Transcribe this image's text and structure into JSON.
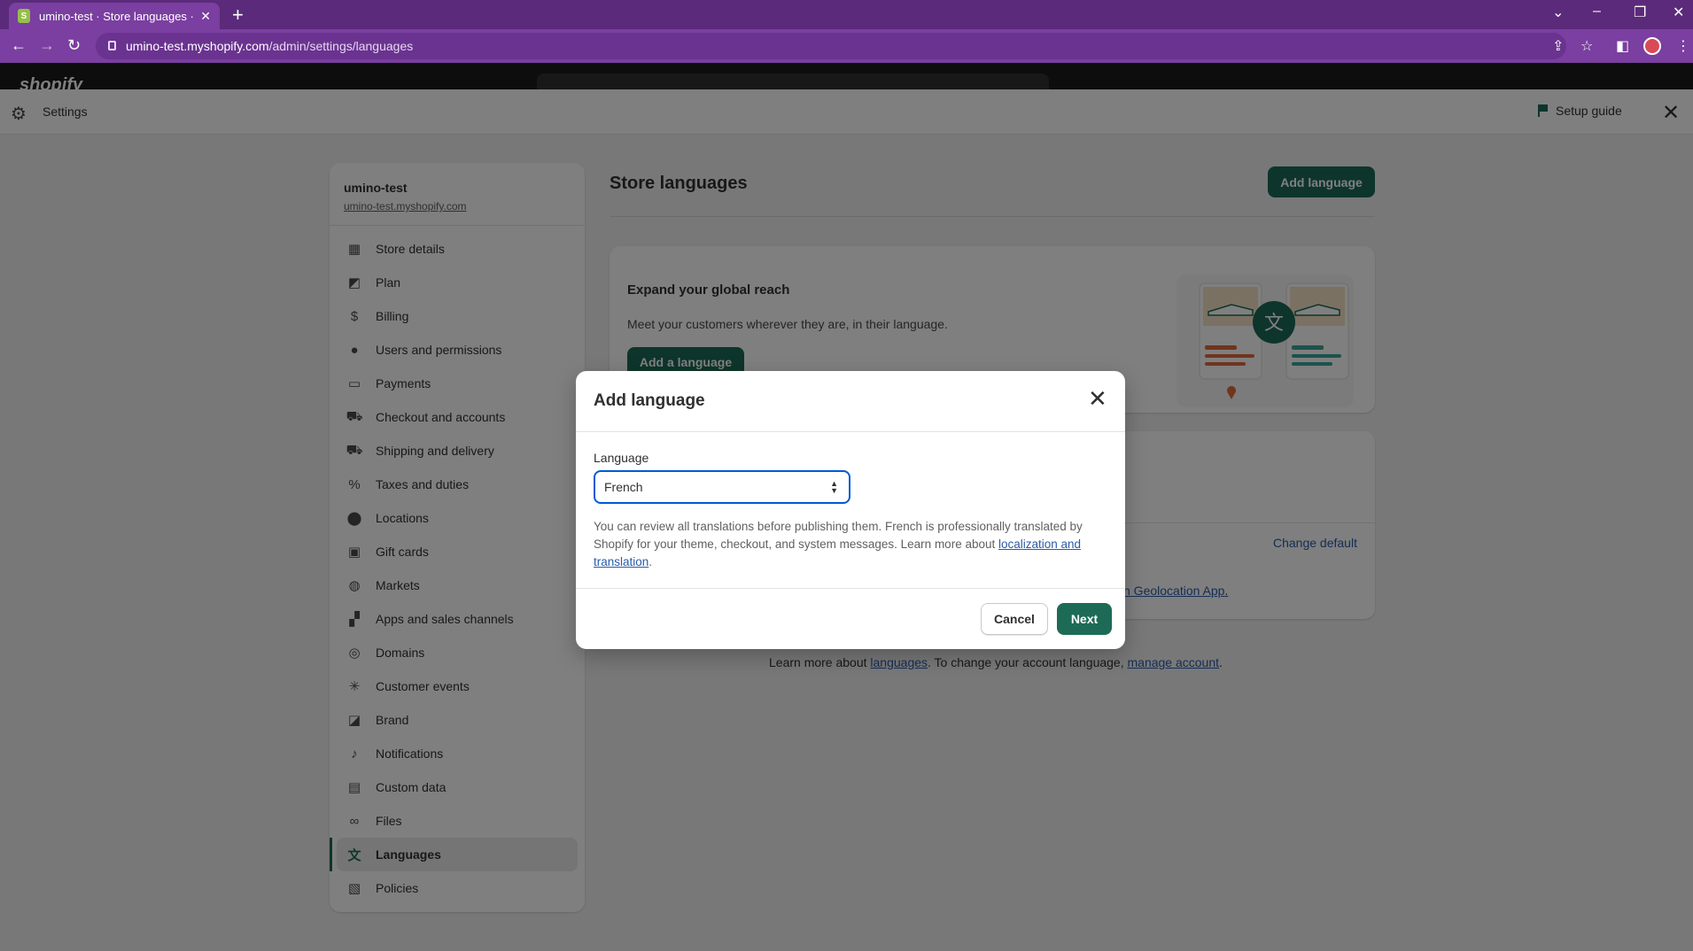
{
  "browser": {
    "tab_title": "umino-test · Store languages · Sh",
    "tab_favicon": "S",
    "url_host": "umino-test.myshopify.com",
    "url_path": "/admin/settings/languages"
  },
  "shopify": {
    "logo_text": "shopify"
  },
  "settings_bar": {
    "title": "Settings",
    "setup_guide": "Setup guide"
  },
  "sidebar": {
    "store_name": "umino-test",
    "store_url": "umino-test.myshopify.com",
    "items": [
      {
        "label": "Store details",
        "icon": "store-icon",
        "glyph": "▦"
      },
      {
        "label": "Plan",
        "icon": "plan-icon",
        "glyph": "◩"
      },
      {
        "label": "Billing",
        "icon": "billing-icon",
        "glyph": "$"
      },
      {
        "label": "Users and permissions",
        "icon": "user-icon",
        "glyph": "●"
      },
      {
        "label": "Payments",
        "icon": "payments-icon",
        "glyph": "▭"
      },
      {
        "label": "Checkout and accounts",
        "icon": "cart-icon",
        "glyph": "⛟"
      },
      {
        "label": "Shipping and delivery",
        "icon": "truck-icon",
        "glyph": "⛟"
      },
      {
        "label": "Taxes and duties",
        "icon": "taxes-icon",
        "glyph": "%"
      },
      {
        "label": "Locations",
        "icon": "location-icon",
        "glyph": "⬤"
      },
      {
        "label": "Gift cards",
        "icon": "gift-icon",
        "glyph": "▣"
      },
      {
        "label": "Markets",
        "icon": "globe-icon",
        "glyph": "◍"
      },
      {
        "label": "Apps and sales channels",
        "icon": "apps-icon",
        "glyph": "▞"
      },
      {
        "label": "Domains",
        "icon": "domains-icon",
        "glyph": "◎"
      },
      {
        "label": "Customer events",
        "icon": "events-icon",
        "glyph": "✳"
      },
      {
        "label": "Brand",
        "icon": "brand-icon",
        "glyph": "◪"
      },
      {
        "label": "Notifications",
        "icon": "bell-icon",
        "glyph": "♪"
      },
      {
        "label": "Custom data",
        "icon": "data-icon",
        "glyph": "▤"
      },
      {
        "label": "Files",
        "icon": "paperclip-icon",
        "glyph": "∞"
      },
      {
        "label": "Languages",
        "icon": "translate-icon",
        "glyph": "文",
        "active": true
      },
      {
        "label": "Policies",
        "icon": "policies-icon",
        "glyph": "▧"
      }
    ]
  },
  "main": {
    "title": "Store languages",
    "add_language_button": "Add language",
    "promo": {
      "heading": "Expand your global reach",
      "text": "Meet your customers wherever they are, in their language.",
      "button": "Add a language"
    },
    "change_default": "Change default",
    "geolocation_link": "n Geolocation App",
    "geolocation_suffix": ".",
    "footer": {
      "prefix": "Learn more about ",
      "link1": "languages",
      "middle": ". To change your account language, ",
      "link2": "manage account",
      "suffix": "."
    }
  },
  "modal": {
    "title": "Add language",
    "field_label": "Language",
    "selected": "French",
    "help_text": "You can review all translations before publishing them. French is professionally translated by Shopify for your theme, checkout, and system messages. Learn more about ",
    "help_link": "localization and translation",
    "help_suffix": ".",
    "cancel": "Cancel",
    "next": "Next"
  },
  "colors": {
    "accent": "#1d6b56",
    "browser": "#7a3fa0",
    "link": "#2a5ba8"
  }
}
